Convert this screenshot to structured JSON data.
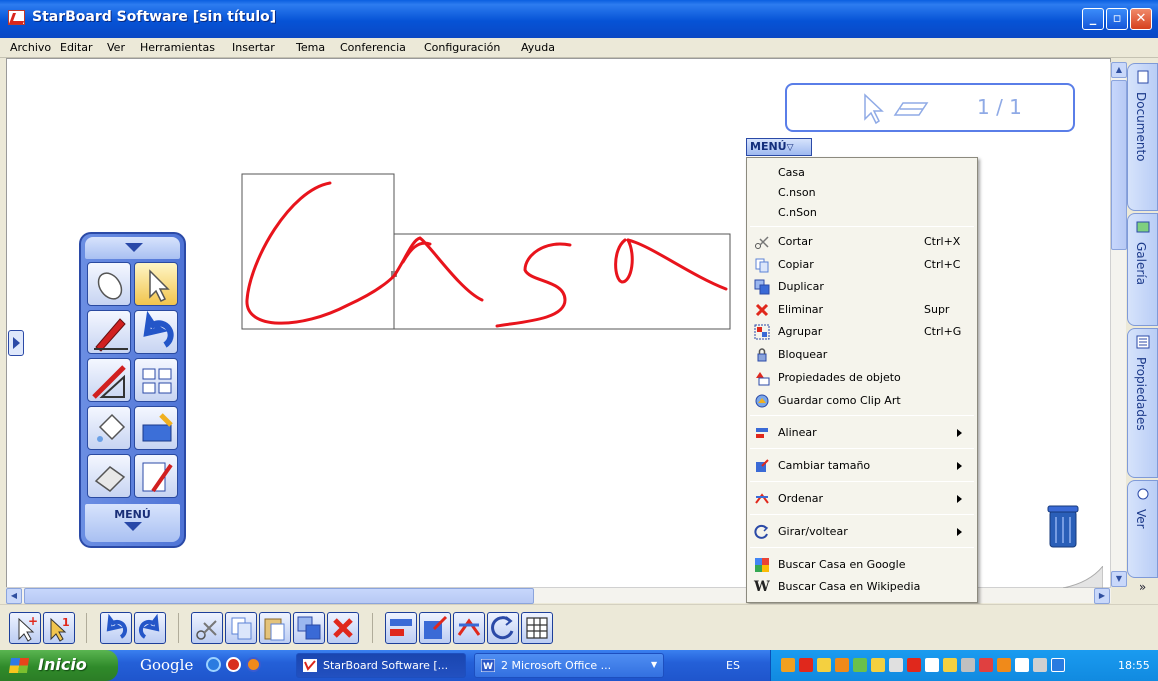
{
  "window": {
    "title": "StarBoard Software [sin título]",
    "controls": {
      "minimize": "_",
      "maximize": "▫",
      "close": "✕"
    }
  },
  "menubar": [
    "Archivo",
    "Editar",
    "Ver",
    "Herramientas",
    "Insertar",
    "Tema",
    "Conferencia",
    "Configuración",
    "Ayuda"
  ],
  "page_indicator": {
    "text": "1 / 1"
  },
  "side_tabs": [
    "Documento",
    "Galería",
    "Propiedades",
    "Ver"
  ],
  "side_scroll_glyph": "»",
  "toolbox": {
    "menu_label": "MENÚ"
  },
  "context_menu": {
    "title": "MENÚ",
    "recognition": [
      "Casa",
      "C.nson",
      "C.nSon"
    ],
    "edit_items": [
      {
        "label": "Cortar",
        "shortcut": "Ctrl+X",
        "icon": "scissors-icon"
      },
      {
        "label": "Copiar",
        "shortcut": "Ctrl+C",
        "icon": "copy-icon"
      },
      {
        "label": "Duplicar",
        "shortcut": "",
        "icon": "duplicate-icon"
      },
      {
        "label": "Eliminar",
        "shortcut": "Supr",
        "icon": "delete-icon"
      },
      {
        "label": "Agrupar",
        "shortcut": "Ctrl+G",
        "icon": "group-icon"
      },
      {
        "label": "Bloquear",
        "shortcut": "",
        "icon": "lock-icon"
      },
      {
        "label": "Propiedades de objeto",
        "shortcut": "",
        "icon": "properties-icon"
      },
      {
        "label": "Guardar como Clip Art",
        "shortcut": "",
        "icon": "clipart-icon"
      }
    ],
    "submenus": [
      {
        "label": "Alinear",
        "icon": "align-icon"
      },
      {
        "label": "Cambiar tamaño",
        "icon": "resize-icon"
      },
      {
        "label": "Ordenar",
        "icon": "order-icon"
      },
      {
        "label": "Girar/voltear",
        "icon": "rotate-icon"
      }
    ],
    "search": [
      {
        "label": "Buscar Casa en Google",
        "icon": "google-icon"
      },
      {
        "label": "Buscar Casa en Wikipedia",
        "icon": "wikipedia-icon"
      }
    ]
  },
  "taskbar": {
    "start_label": "Inicio",
    "google_label": "Google",
    "items": [
      {
        "label": "StarBoard Software [...",
        "active": true
      },
      {
        "label": "2 Microsoft Office ...",
        "active": false
      }
    ],
    "language": "ES",
    "clock": "18:55"
  },
  "colors": {
    "accent": "#2b4aa7",
    "ink": "#e8141c",
    "page_indicator": "#5a7ee8"
  }
}
